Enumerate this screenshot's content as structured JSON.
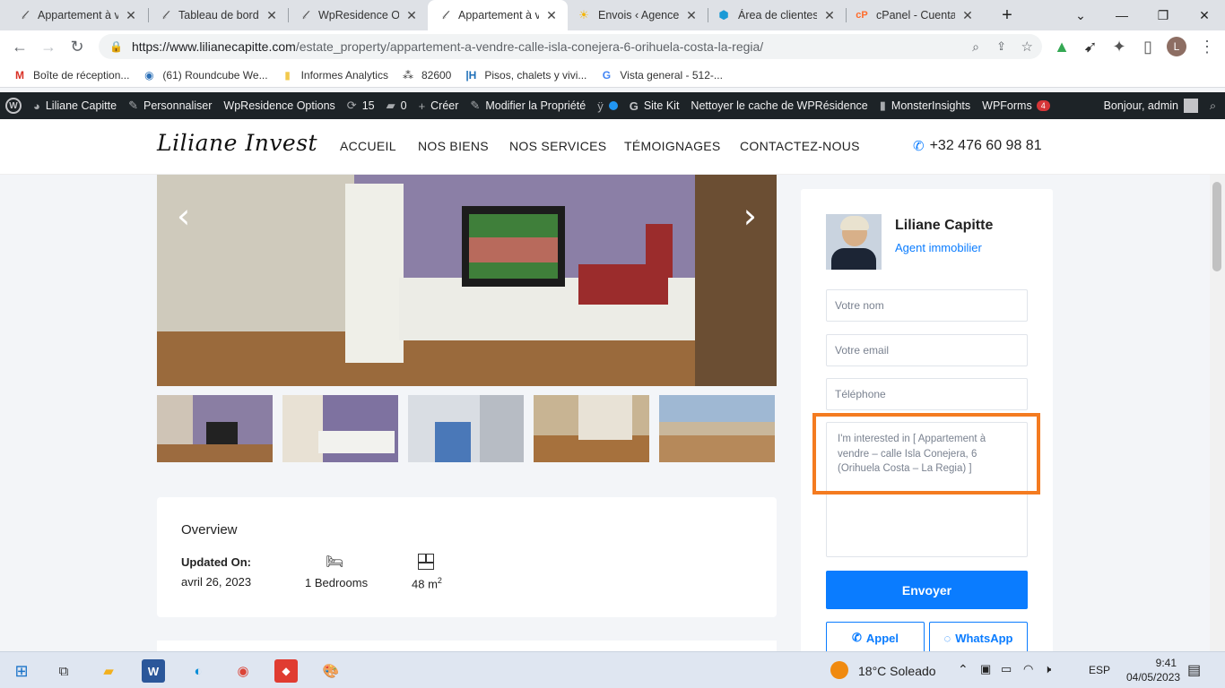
{
  "browser": {
    "tabs": [
      {
        "title": "Appartement à ve",
        "icon": "ll-icon"
      },
      {
        "title": "Tableau de bord",
        "icon": "ll-icon"
      },
      {
        "title": "WpResidence Op",
        "icon": "ll-icon"
      },
      {
        "title": "Appartement à v",
        "icon": "ll-icon",
        "active": true
      },
      {
        "title": "Envois ‹ Agence",
        "icon": "sun-icon"
      },
      {
        "title": "Área de clientes",
        "icon": "cube-icon"
      },
      {
        "title": "cPanel - Cuentas",
        "icon": "cpanel-icon"
      }
    ],
    "new_tab": "+",
    "url_host": "https://www.lilianecapitte.com",
    "url_path": "/estate_property/appartement-a-vendre-calle-isla-conejera-6-orihuela-costa-la-regia/",
    "profile_initial": "L",
    "bookmarks": [
      "Boîte de réception...",
      "(61) Roundcube We...",
      "Informes Analytics",
      "82600",
      "Pisos, chalets y vivi...",
      "Vista general - 512-..."
    ]
  },
  "wpbar": {
    "site": "Liliane Capitte",
    "customize": "Personnaliser",
    "options": "WpResidence Options",
    "updates": "15",
    "comments": "0",
    "create": "Créer",
    "edit": "Modifier la Propriété",
    "sitekit": "Site Kit",
    "cache": "Nettoyer le cache de WPRésidence",
    "insights": "MonsterInsights",
    "wpforms": "WPForms",
    "wpforms_count": "4",
    "greeting": "Bonjour, admin"
  },
  "site": {
    "logo": "Liliane Invest",
    "menu": [
      "ACCUEIL",
      "NOS BIENS",
      "NOS SERVICES",
      "TÉMOIGNAGES",
      "CONTACTEZ-NOUS"
    ],
    "phone": "+32 476 60 98 81"
  },
  "overview": {
    "title": "Overview",
    "updated_label": "Updated On:",
    "updated_value": "avril 26, 2023",
    "bedrooms": "1 Bedrooms",
    "area": "48 m",
    "area_sup": "2"
  },
  "agent": {
    "name": "Liliane Capitte",
    "role": "Agent immobilier",
    "name_placeholder": "Votre nom",
    "email_placeholder": "Votre email",
    "phone_placeholder": "Téléphone",
    "message": "I'm interested in [ Appartement à vendre – calle Isla Conejera, 6 (Orihuela Costa – La Regia) ]",
    "send": "Envoyer",
    "call": "Appel",
    "whatsapp": "WhatsApp"
  },
  "taskbar": {
    "weather_temp": "18°C",
    "weather_text": "Soleado",
    "lang": "ESP",
    "time": "9:41",
    "date": "04/05/2023"
  },
  "colors": {
    "accent": "#0a7cff",
    "highlight": "#f47b20",
    "wpbar": "#1d2327"
  }
}
